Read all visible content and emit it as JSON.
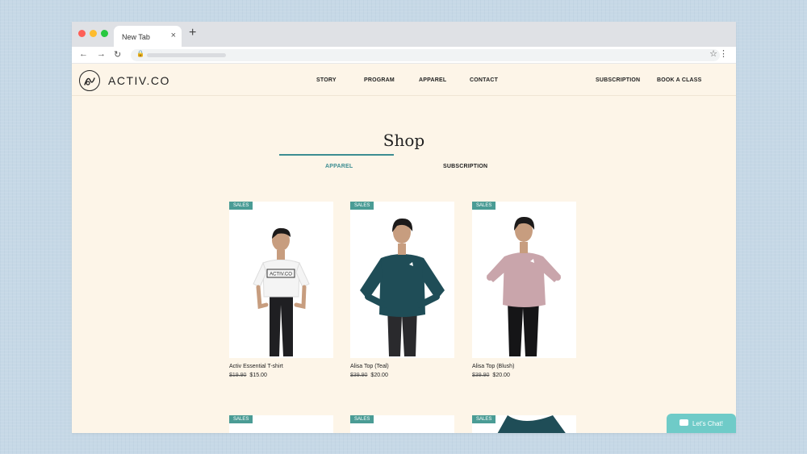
{
  "browser": {
    "tab_title": "New Tab",
    "tab_close": "×",
    "new_tab": "+",
    "back": "←",
    "forward": "→",
    "reload": "↻",
    "lock": "🔒",
    "star": "☆",
    "menu": "⋮"
  },
  "site": {
    "logo_text": "ACTIV.CO",
    "nav": [
      "STORY",
      "PROGRAM",
      "APPAREL",
      "CONTACT"
    ],
    "nav_right": [
      "SUBSCRIPTION",
      "BOOK A CLASS"
    ],
    "page_title": "Shop",
    "tabs": [
      {
        "label": "APPAREL",
        "active": true
      },
      {
        "label": "SUBSCRIPTION",
        "active": false
      }
    ],
    "accent_color": "#3c8d91",
    "badge_color": "#4a9c95"
  },
  "products": [
    {
      "badge": "SALES",
      "name": "Activ Essential T-shirt",
      "old_price": "$19.90",
      "price": "$15.00",
      "shirt_color": "#f4f4f4",
      "print": "ACTIV.CO"
    },
    {
      "badge": "SALES",
      "name": "Alisa Top (Teal)",
      "old_price": "$39.90",
      "price": "$20.00",
      "shirt_color": "#1f4d57"
    },
    {
      "badge": "SALES",
      "name": "Alisa Top (Blush)",
      "old_price": "$39.90",
      "price": "$20.00",
      "shirt_color": "#c9a5ab"
    }
  ],
  "products_row2": [
    {
      "badge": "SALES"
    },
    {
      "badge": "SALES"
    },
    {
      "badge": "SALES"
    }
  ],
  "chat": {
    "label": "Let's Chat!",
    "color": "#6fcbc8"
  }
}
